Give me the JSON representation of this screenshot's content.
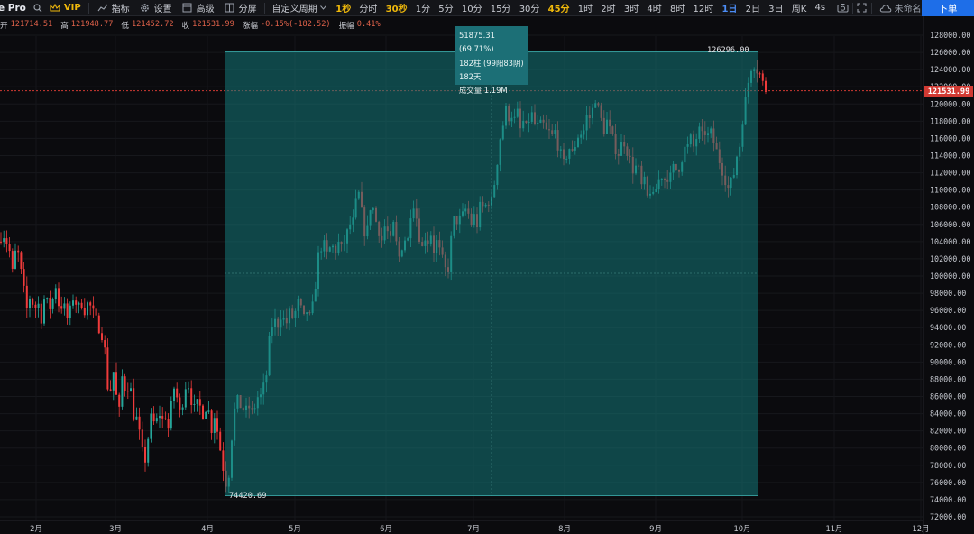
{
  "toolbar": {
    "brand": "e Pro",
    "vip": "VIP",
    "indicators": "指标",
    "settings": "设置",
    "advanced": "高级",
    "split": "分屏",
    "custom_period": "自定义周期",
    "periods": [
      {
        "label": "1秒",
        "style": "y"
      },
      {
        "label": "分时",
        "style": ""
      },
      {
        "label": "30秒",
        "style": "y"
      },
      {
        "label": "1分",
        "style": ""
      },
      {
        "label": "5分",
        "style": ""
      },
      {
        "label": "10分",
        "style": ""
      },
      {
        "label": "15分",
        "style": ""
      },
      {
        "label": "30分",
        "style": ""
      },
      {
        "label": "45分",
        "style": "y"
      },
      {
        "label": "1时",
        "style": ""
      },
      {
        "label": "2时",
        "style": ""
      },
      {
        "label": "3时",
        "style": ""
      },
      {
        "label": "4时",
        "style": ""
      },
      {
        "label": "8时",
        "style": ""
      },
      {
        "label": "12时",
        "style": ""
      },
      {
        "label": "1日",
        "style": "b"
      },
      {
        "label": "2日",
        "style": ""
      },
      {
        "label": "3日",
        "style": ""
      },
      {
        "label": "周K",
        "style": ""
      },
      {
        "label": "4s",
        "style": ""
      }
    ],
    "layout_name": "未命名",
    "order_button": "下单"
  },
  "ohlc": {
    "open_label": "开",
    "open": "121714.51",
    "high_label": "高",
    "high": "121948.77",
    "low_label": "低",
    "low": "121452.72",
    "close_label": "收",
    "close": "121531.99",
    "change_label": "涨幅",
    "change": "-0.15%(-182.52)",
    "amplitude_label": "振幅",
    "amplitude": "0.41%"
  },
  "price_tag": "121531.99",
  "range_tool": {
    "line1": "51875.31 (69.71%)",
    "line2": "182柱 (99阳83阴)",
    "line3": "182天",
    "line4": "成交量 1.19M",
    "high_label": "126296.00",
    "low_label": "74420.69"
  },
  "colors": {
    "up": "#26a69a",
    "down": "#ef3b3b",
    "accent": "#f0b90b",
    "blue": "#1e6ee8"
  },
  "chart_data": {
    "type": "candlestick",
    "interval": "1日",
    "ylim": [
      72000,
      129000
    ],
    "yticks": [
      "128000.00",
      "126000.00",
      "124000.00",
      "122000.00",
      "120000.00",
      "118000.00",
      "116000.00",
      "114000.00",
      "112000.00",
      "110000.00",
      "108000.00",
      "106000.00",
      "104000.00",
      "102000.00",
      "100000.00",
      "98000.00",
      "96000.00",
      "94000.00",
      "92000.00",
      "90000.00",
      "88000.00",
      "86000.00",
      "84000.00",
      "82000.00",
      "80000.00",
      "78000.00",
      "76000.00",
      "74000.00",
      "72000.00"
    ],
    "xticks": [
      "2月",
      "3月",
      "4月",
      "5月",
      "6月",
      "7月",
      "8月",
      "9月",
      "10月",
      "11月",
      "12月"
    ],
    "last_price": 121531.99,
    "range_high": 126296.0,
    "range_low": 74420.69,
    "path": [
      [
        0,
        104000
      ],
      [
        3,
        106000
      ],
      [
        6,
        103000
      ],
      [
        9,
        105000
      ],
      [
        12,
        101000
      ],
      [
        15,
        100000
      ],
      [
        18,
        104000
      ],
      [
        21,
        102000
      ],
      [
        24,
        100000
      ],
      [
        27,
        98000
      ],
      [
        30,
        96000
      ],
      [
        34,
        98000
      ],
      [
        38,
        96000
      ],
      [
        42,
        97000
      ],
      [
        46,
        95000
      ],
      [
        50,
        98000
      ],
      [
        54,
        96000
      ],
      [
        58,
        97000
      ],
      [
        62,
        99000
      ],
      [
        66,
        96000
      ],
      [
        70,
        97000
      ],
      [
        74,
        95000
      ],
      [
        78,
        96000
      ],
      [
        82,
        98000
      ],
      [
        86,
        96000
      ],
      [
        90,
        97000
      ],
      [
        94,
        96000
      ],
      [
        98,
        97000
      ],
      [
        102,
        96000
      ],
      [
        106,
        95000
      ],
      [
        110,
        94000
      ],
      [
        114,
        93000
      ],
      [
        118,
        90000
      ],
      [
        120,
        86000
      ],
      [
        122,
        86500
      ],
      [
        126,
        89000
      ],
      [
        129,
        86000
      ],
      [
        132,
        84000
      ],
      [
        136,
        89000
      ],
      [
        140,
        86000
      ],
      [
        143,
        88000
      ],
      [
        146,
        86000
      ],
      [
        148,
        84000
      ],
      [
        150,
        82000
      ],
      [
        152,
        84000
      ],
      [
        154,
        82000
      ],
      [
        157,
        80000
      ],
      [
        160,
        78000
      ],
      [
        163,
        80000
      ],
      [
        166,
        83000
      ],
      [
        169,
        84000
      ],
      [
        172,
        82000
      ],
      [
        175,
        84000
      ],
      [
        178,
        84000
      ],
      [
        181,
        83000
      ],
      [
        184,
        84000
      ],
      [
        187,
        82000
      ],
      [
        190,
        85000
      ],
      [
        193,
        87000
      ],
      [
        196,
        86000
      ],
      [
        199,
        84000
      ],
      [
        202,
        85000
      ],
      [
        205,
        87000
      ],
      [
        208,
        88000
      ],
      [
        211,
        86000
      ],
      [
        214,
        85000
      ],
      [
        217,
        84000
      ],
      [
        220,
        86000
      ],
      [
        223,
        84000
      ],
      [
        226,
        84000
      ],
      [
        229,
        85000
      ],
      [
        232,
        84000
      ],
      [
        235,
        82000
      ],
      [
        238,
        84000
      ],
      [
        241,
        82000
      ],
      [
        244,
        80000
      ],
      [
        247,
        78000
      ],
      [
        250,
        76000
      ],
      [
        253,
        76000
      ],
      [
        256,
        80000
      ],
      [
        259,
        84000
      ],
      [
        262,
        85000
      ],
      [
        265,
        86000
      ],
      [
        268,
        84000
      ],
      [
        271,
        85000
      ],
      [
        274,
        84000
      ],
      [
        277,
        85000
      ],
      [
        280,
        84000
      ],
      [
        283,
        85000
      ],
      [
        286,
        86000
      ],
      [
        289,
        86000
      ],
      [
        292,
        87000
      ],
      [
        295,
        88000
      ],
      [
        298,
        92000
      ],
      [
        301,
        94000
      ],
      [
        304,
        95000
      ],
      [
        307,
        94000
      ],
      [
        310,
        95000
      ],
      [
        313,
        96000
      ],
      [
        316,
        94000
      ],
      [
        319,
        95000
      ],
      [
        322,
        96000
      ],
      [
        325,
        95000
      ],
      [
        328,
        96000
      ],
      [
        331,
        97000
      ],
      [
        334,
        96000
      ],
      [
        337,
        95000
      ],
      [
        340,
        96000
      ],
      [
        343,
        95000
      ],
      [
        346,
        96000
      ],
      [
        349,
        98000
      ],
      [
        352,
        102000
      ],
      [
        355,
        103000
      ],
      [
        358,
        104000
      ],
      [
        361,
        103000
      ],
      [
        364,
        102000
      ],
      [
        367,
        104000
      ],
      [
        370,
        103000
      ],
      [
        373,
        103000
      ],
      [
        376,
        104000
      ],
      [
        379,
        103000
      ],
      [
        382,
        104000
      ],
      [
        385,
        105000
      ],
      [
        388,
        106000
      ],
      [
        391,
        106000
      ],
      [
        394,
        108000
      ],
      [
        397,
        110000
      ],
      [
        400,
        108000
      ],
      [
        403,
        106000
      ],
      [
        406,
        104000
      ],
      [
        409,
        107000
      ],
      [
        412,
        109000
      ],
      [
        415,
        107000
      ],
      [
        418,
        106000
      ],
      [
        421,
        105000
      ],
      [
        424,
        104000
      ],
      [
        427,
        106000
      ],
      [
        430,
        105000
      ],
      [
        433,
        104000
      ],
      [
        436,
        106000
      ],
      [
        439,
        104000
      ],
      [
        442,
        102000
      ],
      [
        445,
        103000
      ],
      [
        448,
        105000
      ],
      [
        451,
        103000
      ],
      [
        454,
        106000
      ],
      [
        457,
        109000
      ],
      [
        460,
        108000
      ],
      [
        463,
        106000
      ],
      [
        466,
        104000
      ],
      [
        469,
        103000
      ],
      [
        472,
        105000
      ],
      [
        475,
        104000
      ],
      [
        478,
        105000
      ],
      [
        481,
        103000
      ],
      [
        484,
        104000
      ],
      [
        487,
        103000
      ],
      [
        490,
        102000
      ],
      [
        493,
        101000
      ],
      [
        496,
        100000
      ],
      [
        499,
        103000
      ],
      [
        502,
        106000
      ],
      [
        505,
        107000
      ],
      [
        508,
        106000
      ],
      [
        511,
        107000
      ],
      [
        514,
        107000
      ],
      [
        517,
        108000
      ],
      [
        520,
        107000
      ],
      [
        523,
        106000
      ],
      [
        526,
        107000
      ],
      [
        529,
        106000
      ],
      [
        532,
        108000
      ],
      [
        535,
        108000
      ],
      [
        538,
        108000
      ],
      [
        541,
        109000
      ],
      [
        544,
        108000
      ],
      [
        547,
        110000
      ],
      [
        550,
        112000
      ],
      [
        553,
        115000
      ],
      [
        556,
        117000
      ],
      [
        559,
        118000
      ],
      [
        562,
        120000
      ],
      [
        565,
        118000
      ],
      [
        568,
        119000
      ],
      [
        571,
        118000
      ],
      [
        574,
        119000
      ],
      [
        577,
        117000
      ],
      [
        580,
        118000
      ],
      [
        583,
        117000
      ],
      [
        586,
        118000
      ],
      [
        589,
        119000
      ],
      [
        592,
        118000
      ],
      [
        595,
        117000
      ],
      [
        598,
        118000
      ],
      [
        601,
        117000
      ],
      [
        604,
        118000
      ],
      [
        607,
        116000
      ],
      [
        610,
        117000
      ],
      [
        613,
        116000
      ],
      [
        616,
        117000
      ],
      [
        619,
        115000
      ],
      [
        622,
        114000
      ],
      [
        625,
        113000
      ],
      [
        628,
        114000
      ],
      [
        631,
        115000
      ],
      [
        634,
        114000
      ],
      [
        637,
        115000
      ],
      [
        640,
        116000
      ],
      [
        643,
        117000
      ],
      [
        646,
        116000
      ],
      [
        649,
        118000
      ],
      [
        652,
        119000
      ],
      [
        655,
        118000
      ],
      [
        658,
        120000
      ],
      [
        661,
        121000
      ],
      [
        664,
        119000
      ],
      [
        667,
        118000
      ],
      [
        670,
        117000
      ],
      [
        673,
        118000
      ],
      [
        676,
        117000
      ],
      [
        679,
        116000
      ],
      [
        682,
        115000
      ],
      [
        685,
        114000
      ],
      [
        688,
        115000
      ],
      [
        691,
        116000
      ],
      [
        694,
        115000
      ],
      [
        697,
        114000
      ],
      [
        700,
        113000
      ],
      [
        703,
        112000
      ],
      [
        706,
        113000
      ],
      [
        709,
        112000
      ],
      [
        712,
        110000
      ],
      [
        715,
        111000
      ],
      [
        718,
        109000
      ],
      [
        721,
        110000
      ],
      [
        724,
        109000
      ],
      [
        727,
        110000
      ],
      [
        730,
        111000
      ],
      [
        733,
        112000
      ],
      [
        736,
        111000
      ],
      [
        739,
        112000
      ],
      [
        742,
        111000
      ],
      [
        745,
        112000
      ],
      [
        748,
        113000
      ],
      [
        751,
        112000
      ],
      [
        754,
        113000
      ],
      [
        757,
        114000
      ],
      [
        760,
        115000
      ],
      [
        763,
        115000
      ],
      [
        766,
        116000
      ],
      [
        769,
        115000
      ],
      [
        772,
        116000
      ],
      [
        775,
        117000
      ],
      [
        778,
        116000
      ],
      [
        781,
        117000
      ],
      [
        784,
        116000
      ],
      [
        787,
        117000
      ],
      [
        790,
        116000
      ],
      [
        793,
        115000
      ],
      [
        796,
        114000
      ],
      [
        799,
        113000
      ],
      [
        802,
        112000
      ],
      [
        805,
        111000
      ],
      [
        808,
        110000
      ],
      [
        811,
        111000
      ],
      [
        814,
        112000
      ],
      [
        817,
        114000
      ],
      [
        820,
        115000
      ],
      [
        823,
        118000
      ],
      [
        826,
        120000
      ],
      [
        829,
        122000
      ],
      [
        832,
        124000
      ],
      [
        835,
        125000
      ],
      [
        838,
        124000
      ],
      [
        841,
        124000
      ],
      [
        844,
        123000
      ],
      [
        847,
        122000
      ],
      [
        850,
        121500
      ]
    ]
  }
}
